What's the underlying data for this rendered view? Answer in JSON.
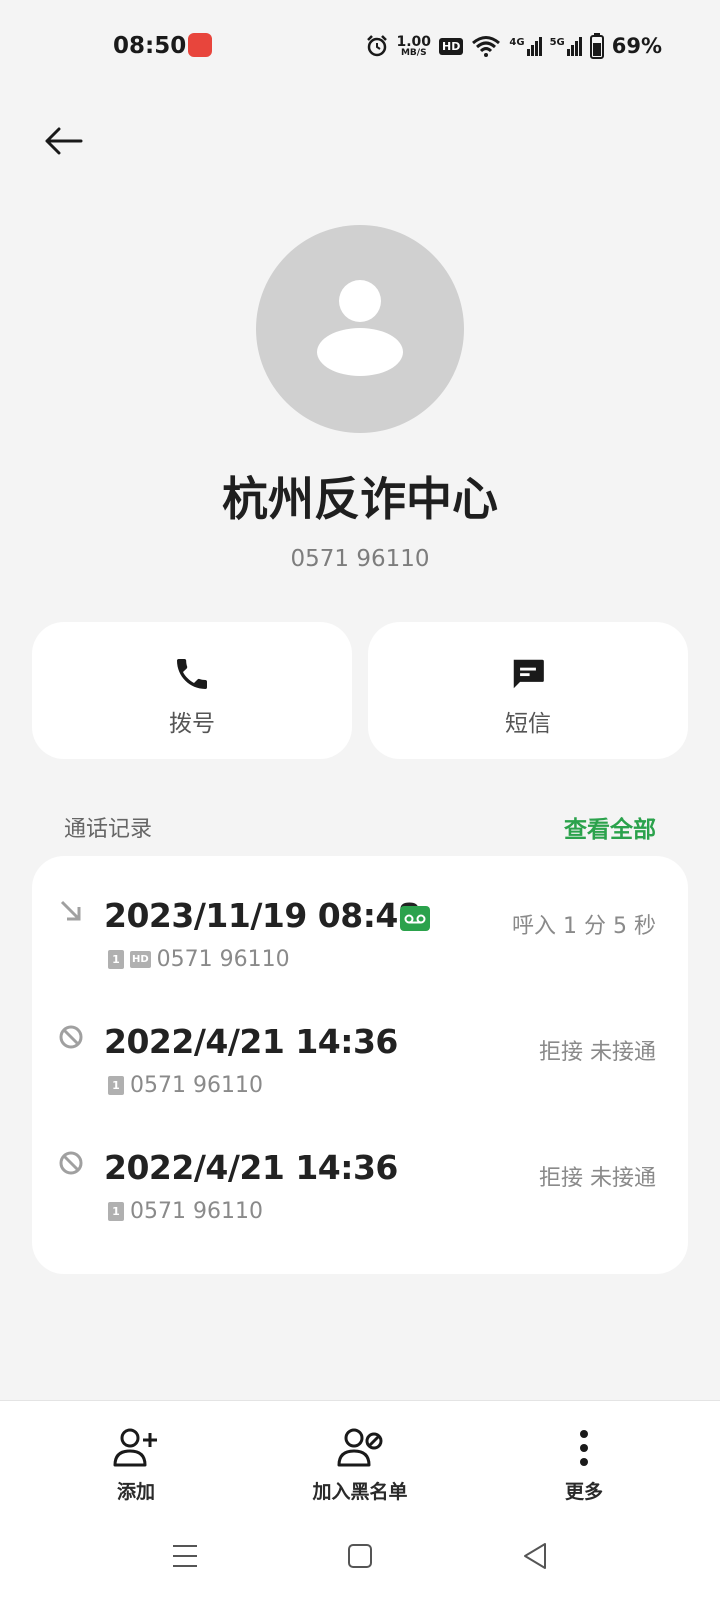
{
  "status_bar": {
    "time": "08:50",
    "speed_value": "1.00",
    "speed_unit": "MB/S",
    "hd_label": "HD",
    "net1_label": "4G",
    "net2_label": "5G",
    "battery_percent": "69%",
    "icons": [
      "app-notification-icon",
      "alarm-icon",
      "hd-icon",
      "wifi-icon",
      "signal-icon",
      "battery-icon"
    ]
  },
  "contact": {
    "name": "杭州反诈中心",
    "number": "0571 96110"
  },
  "actions": {
    "call_label": "拨号",
    "sms_label": "短信"
  },
  "call_log": {
    "title": "通话记录",
    "view_all": "查看全部",
    "entries": [
      {
        "datetime": "2023/11/19 08:48",
        "sim": "1",
        "hd": "HD",
        "number": "0571 96110",
        "status": "呼入  1 分 5 秒",
        "type_icon": "incoming-call-icon",
        "recording": true
      },
      {
        "datetime": "2022/4/21 14:36",
        "sim": "1",
        "number": "0571 96110",
        "status": "拒接 未接通",
        "type_icon": "blocked-call-icon"
      },
      {
        "datetime": "2022/4/21 14:36",
        "sim": "1",
        "number": "0571 96110",
        "status": "拒接 未接通",
        "type_icon": "blocked-call-icon"
      }
    ]
  },
  "bottom_actions": {
    "add_label": "添加",
    "block_label": "加入黑名单",
    "more_label": "更多"
  },
  "colors": {
    "accent": "#2ba24c",
    "background": "#f4f4f4",
    "card": "#ffffff",
    "avatar": "#d0d0d0"
  }
}
